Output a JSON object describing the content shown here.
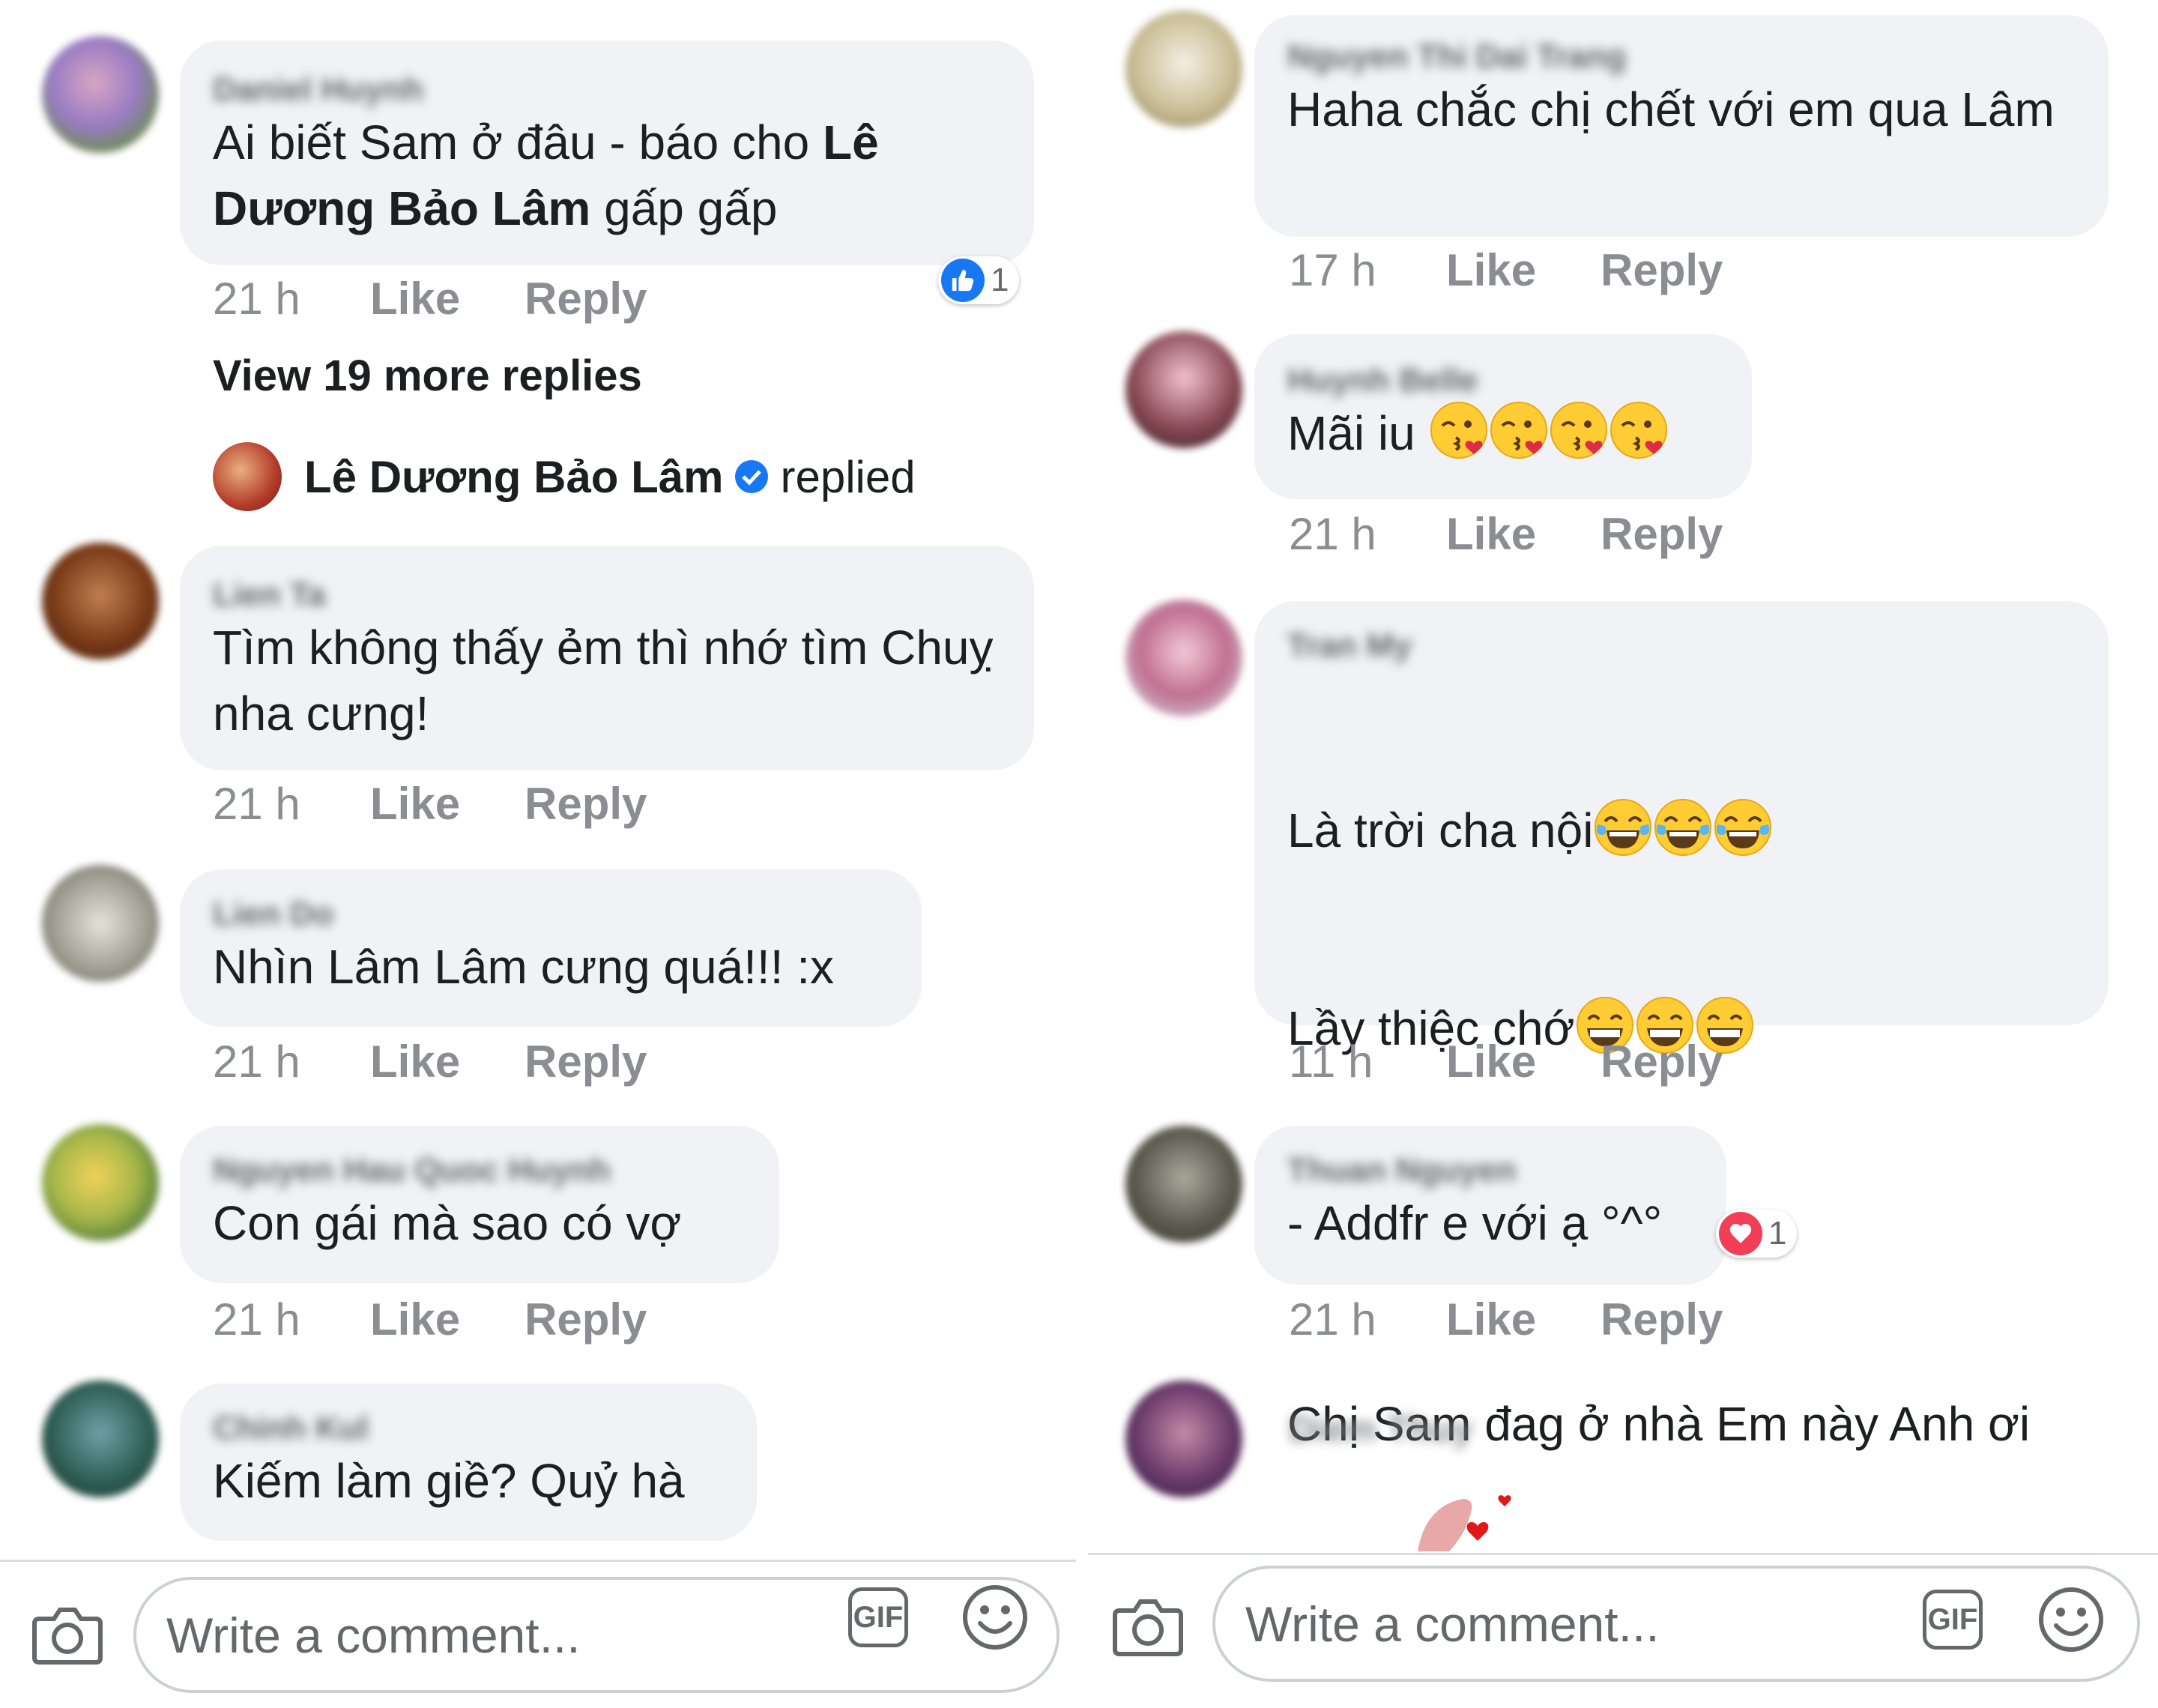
{
  "left": {
    "comments": [
      {
        "author": "Daniel Huynh",
        "text_pre": "Ai biết Sam ở đâu - báo cho ",
        "text_bold": "Lê Dương Bảo Lâm",
        "text_post": " gấp gấp",
        "time": "21 h",
        "like": "Like",
        "reply": "Reply",
        "reaction_count": "1"
      },
      {
        "author": "Lien Ta",
        "text": "Tìm không thấy ẻm thì nhớ tìm Chuỵ  nha cưng!",
        "time": "21 h",
        "like": "Like",
        "reply": "Reply"
      },
      {
        "author": "Lien Do",
        "text": "Nhìn Lâm Lâm cưng quá!!! :x",
        "time": "21 h",
        "like": "Like",
        "reply": "Reply"
      },
      {
        "author": "Nguyen Hau Quoc Huynh",
        "text": "Con gái mà sao có vợ",
        "time": "21 h",
        "like": "Like",
        "reply": "Reply"
      },
      {
        "author": "Chinh Kul",
        "text": "Kiếm làm giề? Quỷ hà"
      }
    ],
    "view_more": "View 19 more replies",
    "replied": {
      "name": "Lê Dương Bảo Lâm",
      "label": "replied"
    },
    "composer": {
      "placeholder": "Write a comment...",
      "gif": "GIF"
    }
  },
  "right": {
    "comments": [
      {
        "author": "Nguyen Thi Dai Trang",
        "text": "Haha chắc chị chết với em qua Lâm",
        "time": "17 h",
        "like": "Like",
        "reply": "Reply"
      },
      {
        "author": "Huynh Belle",
        "text": "Mãi iu ",
        "time": "21 h",
        "like": "Like",
        "reply": "Reply"
      },
      {
        "author": "Tran My",
        "line1": "Là trời cha nội",
        "line2": "Lầy thiệc chớ",
        "line3": "Chị Sam đag ở nhà Em này Anh ơi",
        "time": "11 h",
        "like": "Like",
        "reply": "Reply"
      },
      {
        "author": "Thuan Nguyen",
        "text": "- Addfr e với ạ °^°",
        "time": "21 h",
        "like": "Like",
        "reply": "Reply",
        "reaction_count": "1"
      },
      {
        "author": "Diem Thuy"
      }
    ],
    "composer": {
      "placeholder": "Write a comment...",
      "gif": "GIF"
    }
  },
  "colors": {
    "bubble": "#f0f2f5",
    "like_blue": "#1877f2",
    "love_red": "#f33e58",
    "meta_gray": "#8a8d91"
  },
  "icons": [
    "camera-icon",
    "gif-icon",
    "smiley-icon",
    "like-reaction-icon",
    "love-reaction-icon",
    "verified-badge-icon",
    "kiss-emoji",
    "tears-of-joy-emoji",
    "grin-emoji",
    "sweat-smile-emoji"
  ]
}
